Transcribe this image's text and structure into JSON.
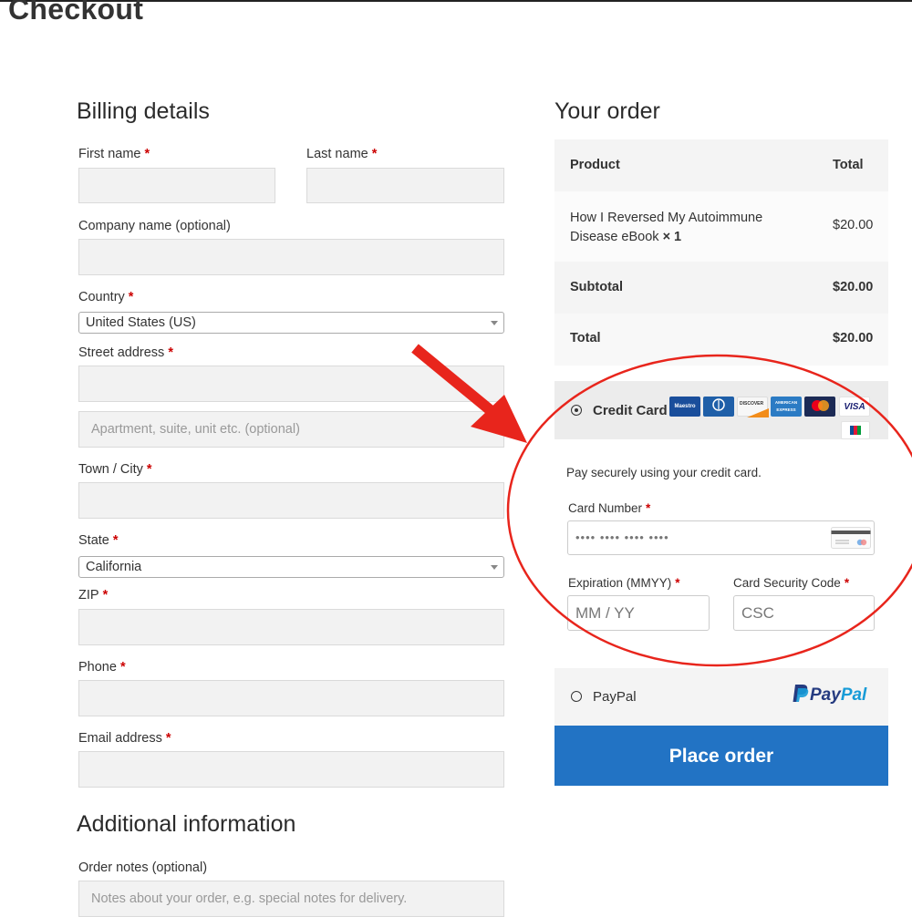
{
  "page": {
    "title": "Checkout"
  },
  "billing": {
    "title": "Billing details",
    "required_mark": "*",
    "first_name": {
      "label": "First name",
      "value": ""
    },
    "last_name": {
      "label": "Last name",
      "value": ""
    },
    "company": {
      "label": "Company name (optional)",
      "value": ""
    },
    "country": {
      "label": "Country",
      "value": "United States (US)"
    },
    "street": {
      "label": "Street address",
      "value": "",
      "placeholder2": "Apartment, suite, unit etc. (optional)"
    },
    "city": {
      "label": "Town / City",
      "value": ""
    },
    "state": {
      "label": "State",
      "value": "California"
    },
    "zip": {
      "label": "ZIP",
      "value": ""
    },
    "phone": {
      "label": "Phone",
      "value": ""
    },
    "email": {
      "label": "Email address",
      "value": ""
    }
  },
  "additional": {
    "title": "Additional information",
    "notes_label": "Order notes (optional)",
    "notes_placeholder": "Notes about your order, e.g. special notes for delivery."
  },
  "order": {
    "title": "Your order",
    "header": {
      "product": "Product",
      "total": "Total"
    },
    "item": {
      "name_line1": "How I Reversed My Autoimmune",
      "name_line2": "Disease eBook",
      "qty": "× 1",
      "price": "$20.00"
    },
    "subtotal": {
      "label": "Subtotal",
      "value": "$20.00"
    },
    "total": {
      "label": "Total",
      "value": "$20.00"
    }
  },
  "payment": {
    "credit_card": {
      "label": "Credit Card",
      "selected": true,
      "description": "Pay securely using your credit card.",
      "card_number_label": "Card Number",
      "card_number_placeholder": "•••• •••• •••• ••••",
      "expiry_label": "Expiration (MMYY)",
      "expiry_placeholder": "MM / YY",
      "csc_label": "Card Security Code",
      "csc_placeholder": "CSC",
      "card_icons": [
        "maestro-icon",
        "diners-club-icon",
        "discover-icon",
        "american-express-icon",
        "mastercard-icon",
        "visa-icon",
        "jcb-icon"
      ],
      "icon_text": {
        "maestro": "Maestro",
        "discover": "DISCOVER",
        "amex": "AMERICAN EXPRESS",
        "visa": "VISA",
        "jcb": "JCB"
      }
    },
    "paypal": {
      "label": "PayPal",
      "selected": false,
      "logo_text_1": "Pay",
      "logo_text_2": "Pal"
    }
  },
  "place_order_label": "Place order",
  "colors": {
    "accent": "#2273c4",
    "required": "#cc0000",
    "annotation": "#e8251c"
  }
}
